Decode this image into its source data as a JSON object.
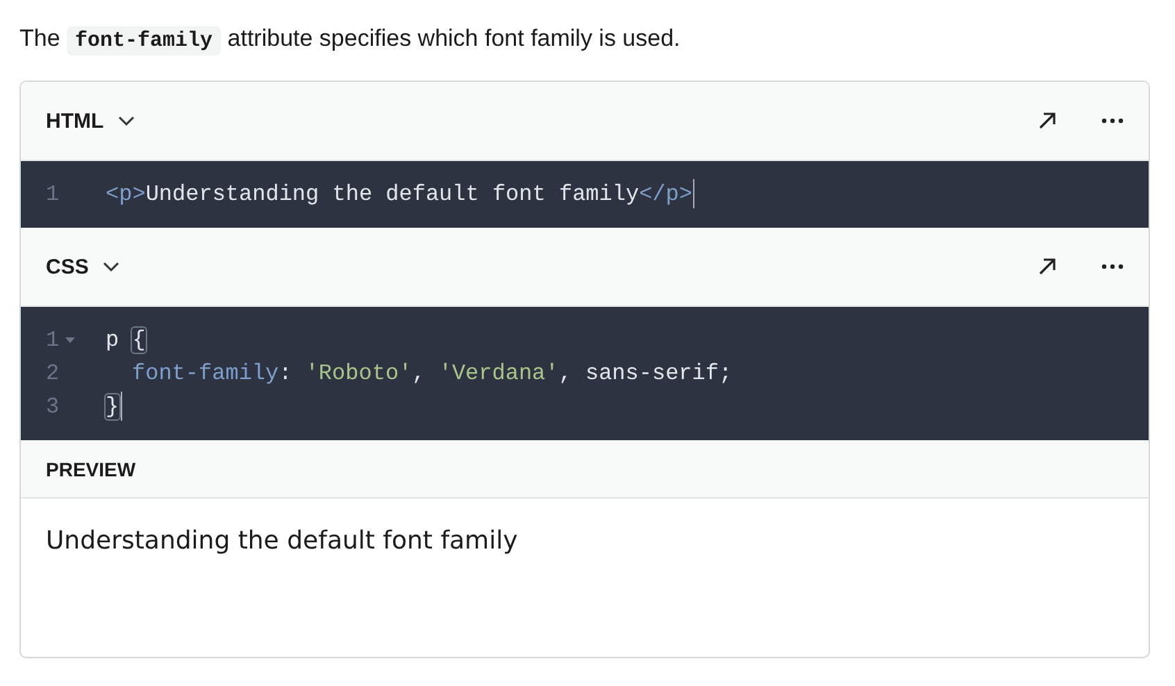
{
  "intro": {
    "before": "The",
    "code": "font-family",
    "after": "attribute specifies which font family is used."
  },
  "editors": [
    {
      "label": "HTML",
      "lines": [
        {
          "number": "1",
          "foldable": false,
          "cursor": true,
          "tokens": [
            {
              "kind": "tag",
              "text": "<p>"
            },
            {
              "kind": "plain",
              "text": "Understanding the default font family"
            },
            {
              "kind": "tag",
              "text": "</p>"
            }
          ]
        }
      ]
    },
    {
      "label": "CSS",
      "lines": [
        {
          "number": "1",
          "foldable": true,
          "cursor": false,
          "tokens": [
            {
              "kind": "plain",
              "text": "p "
            },
            {
              "kind": "bracket",
              "text": "{"
            }
          ]
        },
        {
          "number": "2",
          "foldable": false,
          "cursor": false,
          "indented": true,
          "tokens": [
            {
              "kind": "property",
              "text": "font-family"
            },
            {
              "kind": "plain",
              "text": ": "
            },
            {
              "kind": "string",
              "text": "'Roboto'"
            },
            {
              "kind": "plain",
              "text": ", "
            },
            {
              "kind": "string",
              "text": "'Verdana'"
            },
            {
              "kind": "plain",
              "text": ", sans-serif;"
            }
          ]
        },
        {
          "number": "3",
          "foldable": false,
          "cursor": true,
          "tokens": [
            {
              "kind": "bracket",
              "text": "}"
            }
          ]
        }
      ]
    }
  ],
  "preview": {
    "label": "PREVIEW",
    "text": "Understanding the default font family"
  }
}
